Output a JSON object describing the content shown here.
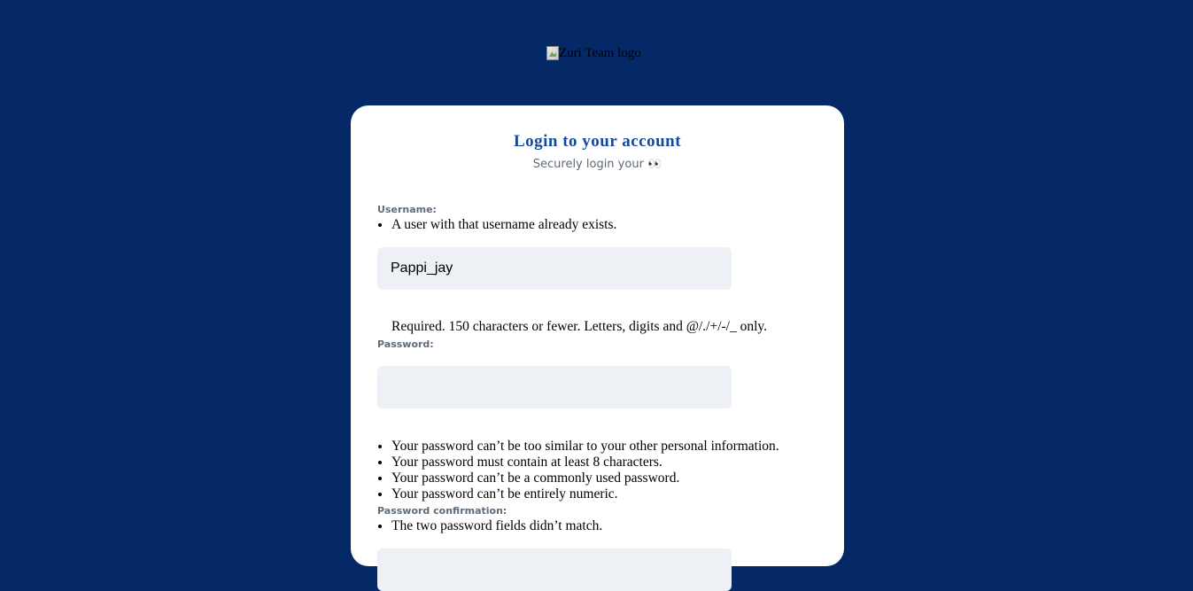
{
  "logo": {
    "alt": "Zuri Team logo",
    "icon": "broken-image-icon"
  },
  "card": {
    "title": "Login to your account",
    "subtitle": "Securely login your 👀"
  },
  "username": {
    "label": "Username:",
    "errors": [
      "A user with that username already exists."
    ],
    "value": "Pappi_jay",
    "helptext": "Required. 150 characters or fewer. Letters, digits and @/./+/-/_ only."
  },
  "password": {
    "label": "Password:",
    "value": "",
    "help_items": [
      "Your password can’t be too similar to your other personal information.",
      "Your password must contain at least 8 characters.",
      "Your password can’t be a commonly used password.",
      "Your password can’t be entirely numeric."
    ]
  },
  "password_confirmation": {
    "label": "Password confirmation:",
    "errors": [
      "The two password fields didn’t match."
    ],
    "value": ""
  },
  "colors": {
    "background": "#052866",
    "card": "#ffffff",
    "title": "#134a9b",
    "input_bg": "#edf1f5",
    "label": "#5e6b7a"
  }
}
